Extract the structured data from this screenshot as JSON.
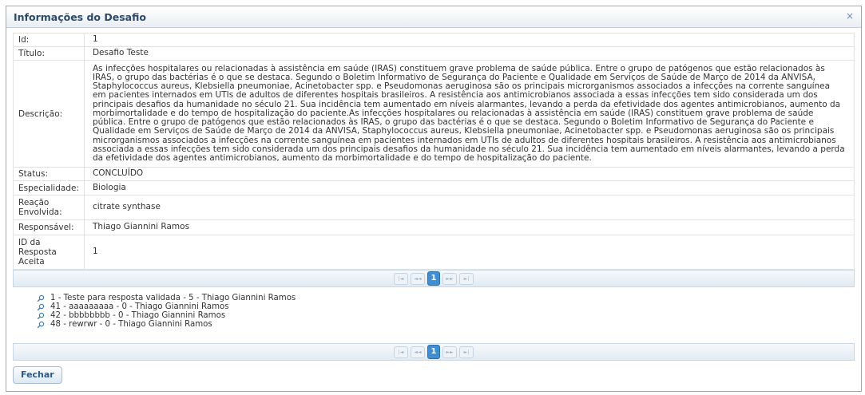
{
  "dialog": {
    "title": "Informações do Desafio",
    "close_symbol": "×"
  },
  "details": [
    {
      "label": "Id:",
      "value": "1"
    },
    {
      "label": "Título:",
      "value": "Desafio Teste"
    },
    {
      "label": "Descrição:",
      "value": "As infecções hospitalares ou relacionadas à assistência em saúde (IRAS) constituem grave problema de saúde pública. Entre o grupo de patógenos que estão relacionados às IRAS, o grupo das bactérias é o que se destaca. Segundo o Boletim Informativo de Segurança do Paciente e Qualidade em Serviços de Saúde de Março de 2014 da ANVISA, Staphylococcus aureus, Klebsiella pneumoniae, Acinetobacter spp. e Pseudomonas aeruginosa são os principais microrganismos associados a infecções na corrente sanguínea em pacientes internados em UTIs de adultos de diferentes hospitais brasileiros. A resistência aos antimicrobianos associada a essas infecções tem sido considerada um dos principais desafios da humanidade no século 21. Sua incidência tem aumentado em níveis alarmantes, levando a perda da efetividade dos agentes antimicrobianos, aumento da morbimortalidade e do tempo de hospitalização do paciente.As infecções hospitalares ou relacionadas à assistência em saúde (IRAS) constituem grave problema de saúde pública. Entre o grupo de patógenos que estão relacionados às IRAS, o grupo das bactérias é o que se destaca. Segundo o Boletim Informativo de Segurança do Paciente e Qualidade em Serviços de Saúde de Março de 2014 da ANVISA, Staphylococcus aureus, Klebsiella pneumoniae, Acinetobacter spp. e Pseudomonas aeruginosa são os principais microrganismos associados a infecções na corrente sanguínea em pacientes internados em UTIs de adultos de diferentes hospitais brasileiros. A resistência aos antimicrobianos associada a essas infecções tem sido considerada um dos principais desafios da humanidade no século 21. Sua incidência tem aumentado em níveis alarmantes, levando a perda da efetividade dos agentes antimicrobianos, aumento da morbimortalidade e do tempo de hospitalização do paciente."
    },
    {
      "label": "Status:",
      "value": "CONCLUÍDO"
    },
    {
      "label": "Especialidade:",
      "value": "Biologia"
    },
    {
      "label": "Reação Envolvida:",
      "value": "citrate synthase"
    },
    {
      "label": "Responsável:",
      "value": "Thiago Giannini Ramos"
    },
    {
      "label": "ID da Resposta Aceita",
      "value": "1"
    }
  ],
  "paginator": {
    "first": "|◄",
    "prev": "◄◄",
    "current_page": "1",
    "next": "►►",
    "last": "►|"
  },
  "responses": [
    "1 - Teste para resposta validada - 5 - Thiago Giannini Ramos",
    "41 - aaaaaaaaa - 0 - Thiago Giannini Ramos",
    "42 - bbbbbbbb - 0 - Thiago Giannini Ramos",
    "48 - rewrwr - 0 - Thiago Giannini Ramos"
  ],
  "footer": {
    "close_button": "Fechar"
  },
  "colors": {
    "accent": "#3e8ed6",
    "title_text": "#2c4a6a"
  },
  "icons": {
    "response_item": "magnifier-icon",
    "close": "close-icon"
  }
}
